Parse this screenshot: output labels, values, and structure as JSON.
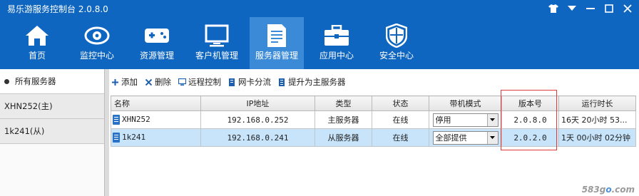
{
  "app": {
    "title": "易乐游服务控制台 2.0.8.0"
  },
  "nav": [
    {
      "label": "首页",
      "icon": "home-icon",
      "active": false
    },
    {
      "label": "监控中心",
      "icon": "eye-icon",
      "active": false
    },
    {
      "label": "资源管理",
      "icon": "gamepad-icon",
      "active": false
    },
    {
      "label": "客户机管理",
      "icon": "monitor-icon",
      "active": false
    },
    {
      "label": "服务器管理",
      "icon": "server-doc-icon",
      "active": true
    },
    {
      "label": "应用中心",
      "icon": "toolbox-icon",
      "active": false
    },
    {
      "label": "安全中心",
      "icon": "shield-icon",
      "active": false
    }
  ],
  "sidebar": {
    "items": [
      {
        "label": "所有服务器",
        "selected": true
      },
      {
        "label": "XHN252(主)",
        "selected": false
      },
      {
        "label": "1k241(从)",
        "selected": false
      }
    ]
  },
  "toolbar": {
    "add": "添加",
    "delete": "删除",
    "remote": "远程控制",
    "nic": "网卡分流",
    "promote": "提升为主服务器"
  },
  "table": {
    "columns": [
      "名称",
      "IP地址",
      "类型",
      "状态",
      "带机模式",
      "版本号",
      "运行时长"
    ],
    "rows": [
      {
        "name": "XHN252",
        "ip": "192.168.0.252",
        "type": "主服务器",
        "status": "在线",
        "mode": "停用",
        "version": "2.0.8.0",
        "uptime": "16天 20小时 53..."
      },
      {
        "name": "1k241",
        "ip": "192.168.0.241",
        "type": "从服务器",
        "status": "在线",
        "mode": "全部提供",
        "version": "2.0.2.0",
        "uptime": "1天 00小时 02分钟"
      }
    ]
  },
  "watermark": {
    "text1": "583g",
    "text2": "o",
    "text3": ".com"
  },
  "colors": {
    "topbar": "#0f66c1",
    "active_nav": "#3a8ad8",
    "selected_row": "#c7e4fb",
    "highlight": "#e03a3a"
  }
}
